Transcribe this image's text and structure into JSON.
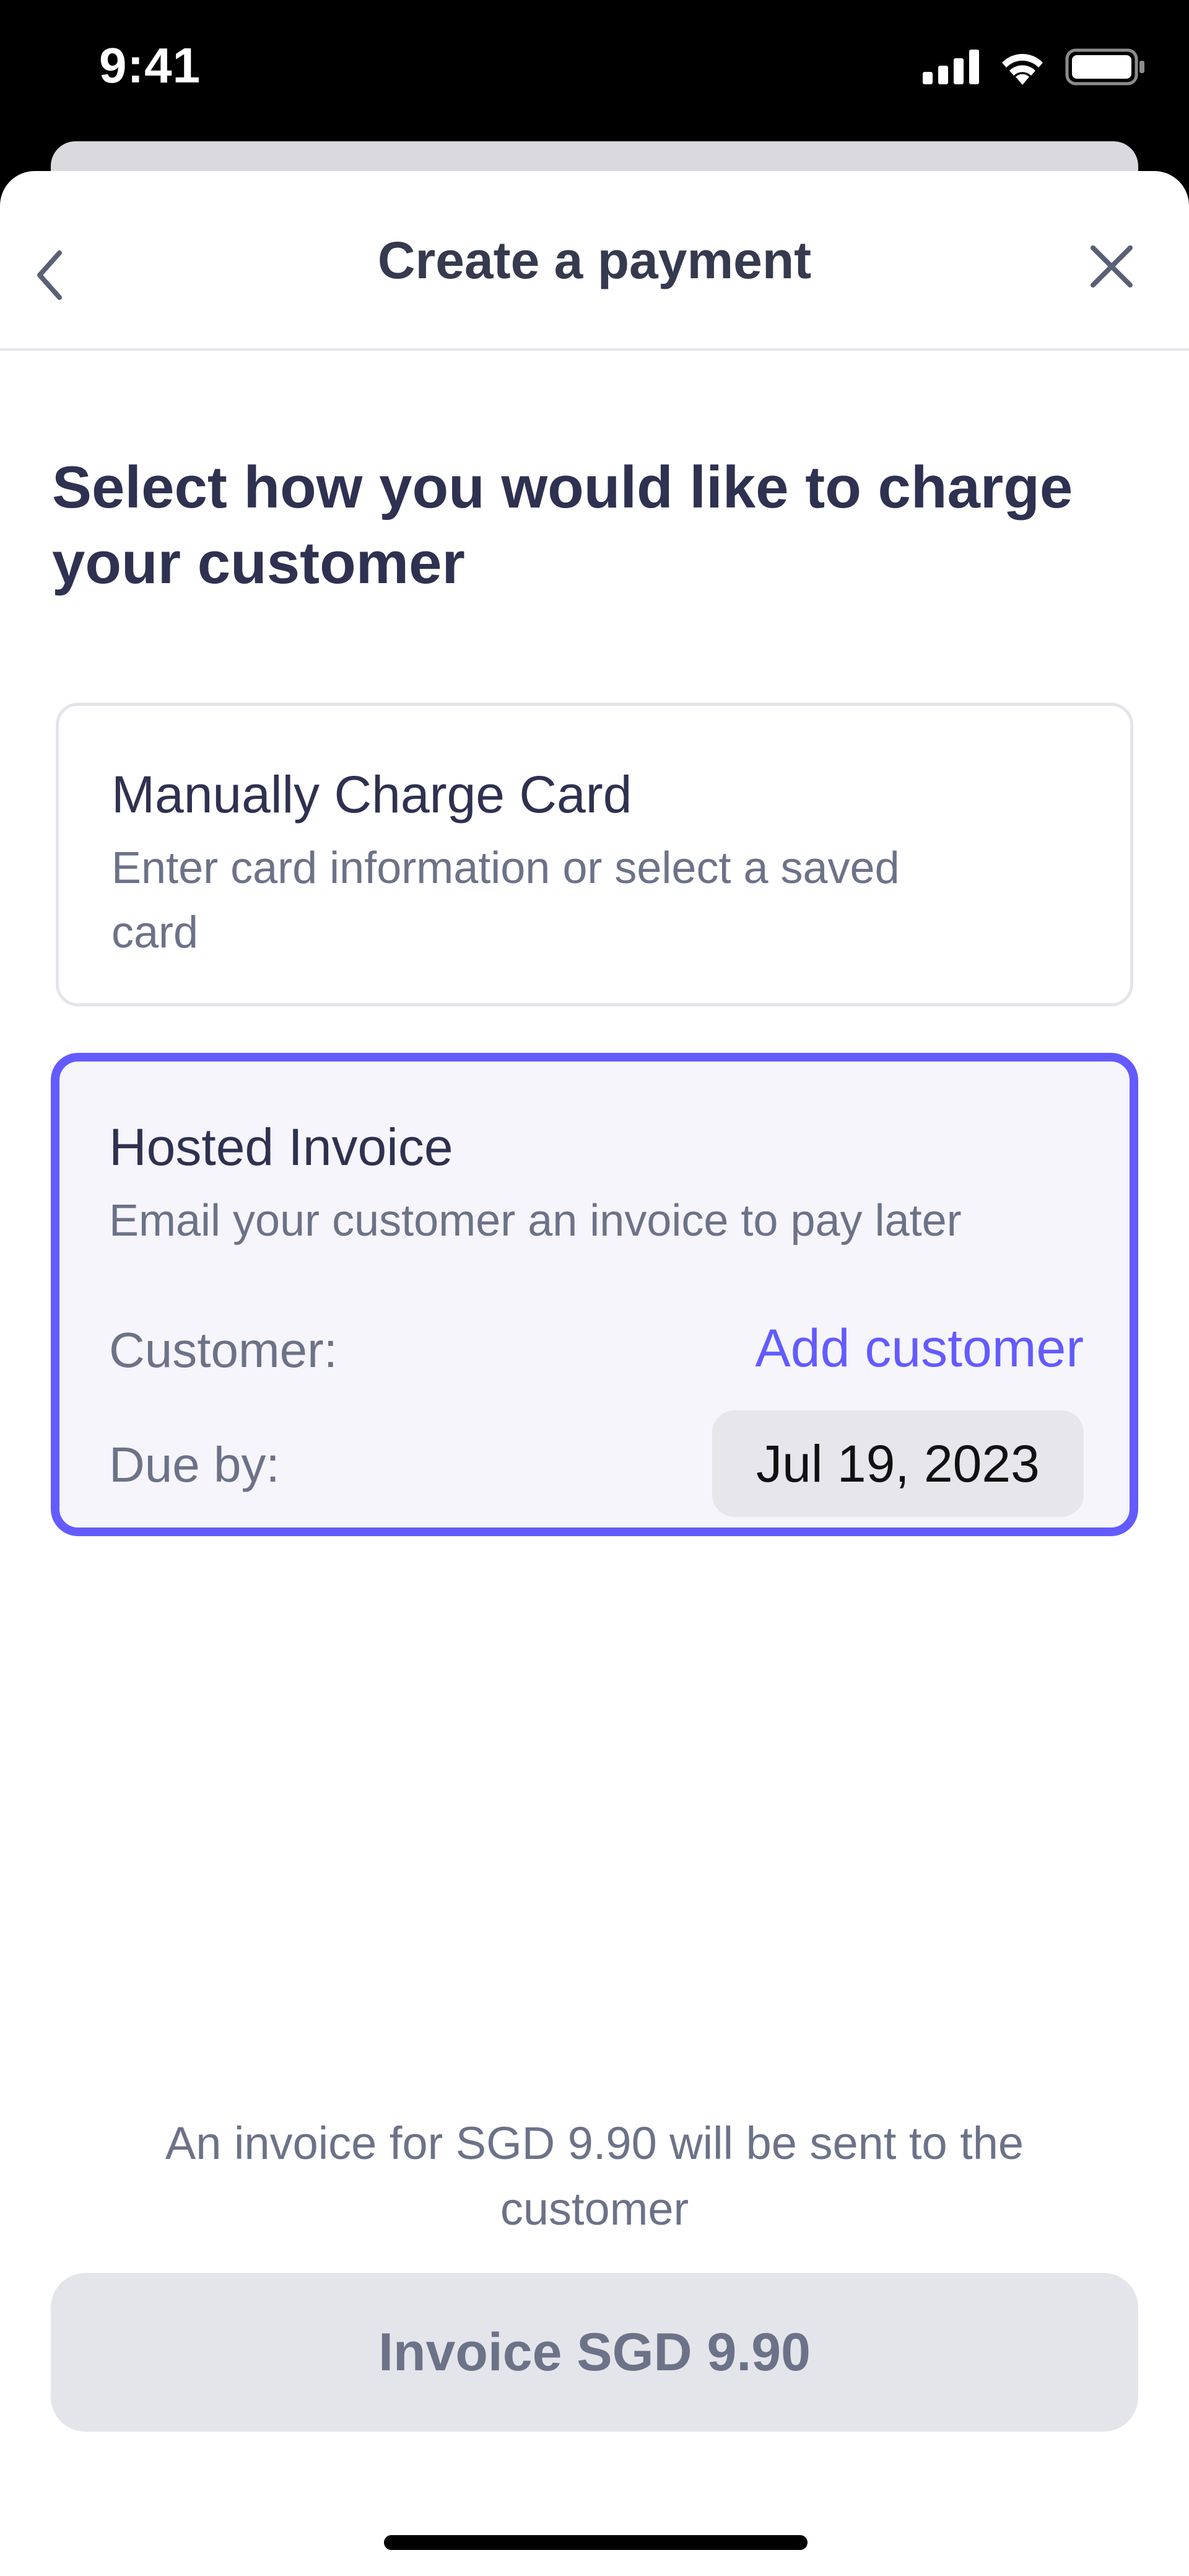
{
  "status_bar": {
    "time": "9:41",
    "icons": [
      "cellular-signal-icon",
      "wifi-icon",
      "battery-icon"
    ]
  },
  "header": {
    "title": "Create a payment",
    "back_icon": "chevron-left-icon",
    "close_icon": "close-icon"
  },
  "heading": "Select how you would like to charge your customer",
  "options": [
    {
      "title": "Manually Charge Card",
      "description": "Enter card information or select a saved card",
      "selected": false
    },
    {
      "title": "Hosted Invoice",
      "description": "Email your customer an invoice to pay later",
      "selected": true,
      "customer_label": "Customer:",
      "customer_action": "Add customer",
      "due_label": "Due by:",
      "due_date": "Jul 19, 2023"
    }
  ],
  "footer": {
    "note": "An invoice for SGD 9.90 will be sent to the customer",
    "button_label": "Invoice SGD 9.90"
  },
  "colors": {
    "accent": "#635bff",
    "text_primary": "#2e3150",
    "text_secondary": "#6c7288",
    "selected_card_bg": "#f6f5fb",
    "disabled_button_bg": "#e3e5ea"
  }
}
